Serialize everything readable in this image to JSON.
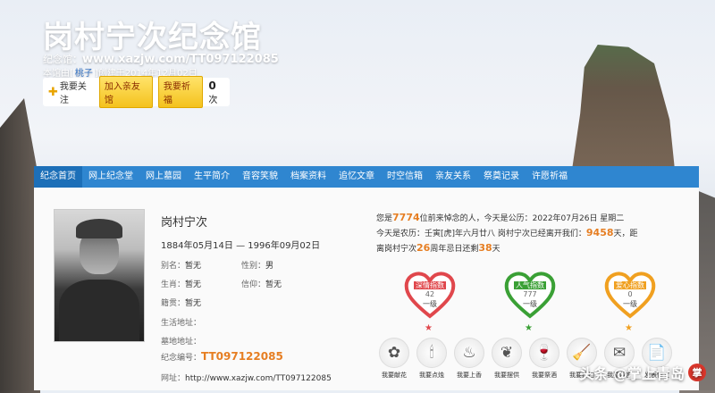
{
  "header": {
    "title": "岗村宁次纪念馆",
    "url_label": "纪念馆：",
    "url": "www.xazjw.com/TT097122085",
    "meta_prefix": "本馆由[",
    "meta_creator": "桃子",
    "meta_suffix": "]创建于2014年12月02日",
    "follow_label": "我要关注",
    "join_label": "加入亲友馆",
    "pray_label": "我要祈福",
    "count_value": "0",
    "count_unit": "次"
  },
  "nav": [
    "纪念首页",
    "网上纪念堂",
    "网上墓园",
    "生平简介",
    "音容笑貌",
    "档案资料",
    "追忆文章",
    "时空信箱",
    "亲友关系",
    "祭奠记录",
    "许愿祈福"
  ],
  "profile": {
    "name": "岗村宁次",
    "dates": "1884年05月14日 — 1996年09月02日",
    "alias_label": "别名：",
    "alias_value": "暂无",
    "gender_label": "性别：",
    "gender_value": "男",
    "zodiac_label": "生肖：",
    "zodiac_value": "暂无",
    "faith_label": "信仰：",
    "faith_value": "暂无",
    "origin_label": "籍贯：",
    "origin_value": "暂无",
    "birthplace_label": "生活地址：",
    "birthplace_value": "",
    "cemetery_label": "墓地地址：",
    "cemetery_value": "",
    "serial_label": "纪念编号：",
    "serial_value": "TT097122085",
    "web_label": "网址：",
    "web_value": "http://www.xazjw.com/TT097122085"
  },
  "info": {
    "line1_a": "您是",
    "line1_num": "7774",
    "line1_b": "位前来悼念的人，今天是公历：2022年07月26日 星期二",
    "line2_a": "今天是农历：壬寅[虎]年六月廿八 岗村宁次已经离开我们：",
    "line2_num": "9458",
    "line2_b": "天，距",
    "line3_a": "离岗村宁次",
    "line3_num1": "26",
    "line3_b": "周年忌日还剩",
    "line3_num2": "38",
    "line3_c": "天"
  },
  "hearts": [
    {
      "label": "深情指数",
      "value": "42",
      "level": "一级",
      "color": "#e0474c"
    },
    {
      "label": "人气指数",
      "value": "777",
      "level": "一级",
      "color": "#3aa035"
    },
    {
      "label": "爱心指数",
      "value": "0",
      "level": "一级",
      "color": "#f0a020"
    }
  ],
  "actions": [
    {
      "label": "我要献花",
      "icon": "flower-icon",
      "glyph": "✿"
    },
    {
      "label": "我要点烛",
      "icon": "candle-icon",
      "glyph": "🕯"
    },
    {
      "label": "我要上香",
      "icon": "incense-icon",
      "glyph": "♨"
    },
    {
      "label": "我要摆供",
      "icon": "offering-icon",
      "glyph": "❦"
    },
    {
      "label": "我要祭酒",
      "icon": "wine-icon",
      "glyph": "🍷"
    },
    {
      "label": "我要打扫",
      "icon": "broom-icon",
      "glyph": "🧹"
    },
    {
      "label": "我要留言",
      "icon": "envelope-icon",
      "glyph": "✉"
    },
    {
      "label": "发表悼文",
      "icon": "document-icon",
      "glyph": "📄"
    }
  ],
  "watermark": {
    "text": "头条 @掌上青岛",
    "logo": "掌"
  }
}
